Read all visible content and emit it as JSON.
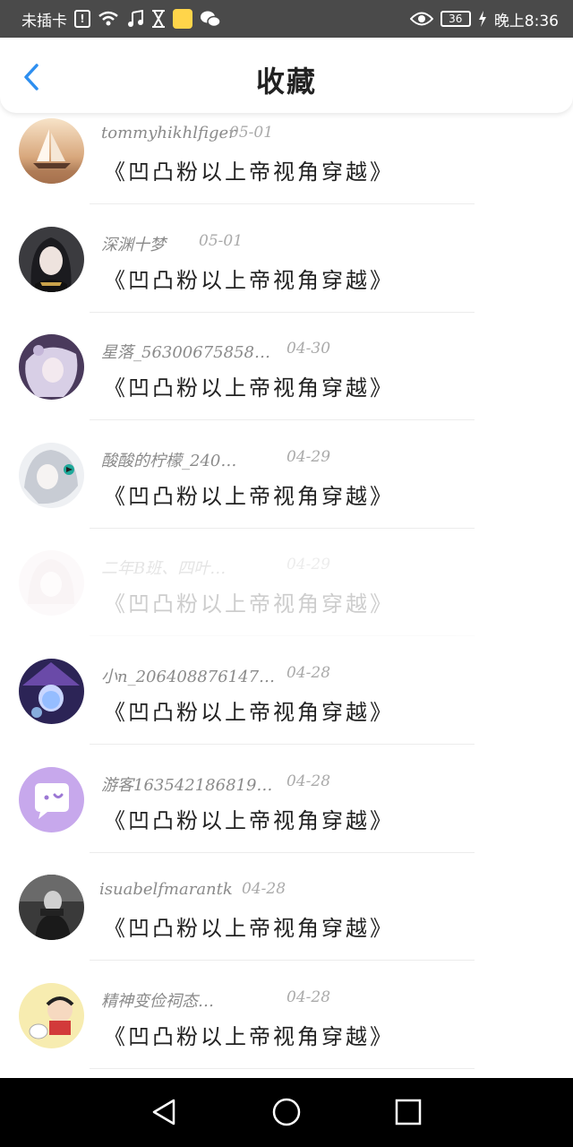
{
  "status_bar": {
    "carrier": "未插卡",
    "battery": "36",
    "time": "晚上8:36",
    "colors": {
      "bg": "#4a4a4a",
      "fg": "#ffffff"
    },
    "icons": [
      "alert-box-icon",
      "wifi-icon",
      "music-note-icon",
      "hourglass-icon",
      "app-notification-icon",
      "wechat-icon",
      "eye-icon",
      "battery-icon",
      "charging-bolt-icon"
    ]
  },
  "header": {
    "title": "收藏",
    "back_icon": "chevron-left-icon",
    "accent": "#2e8ff0"
  },
  "items": [
    {
      "username": "tommyhikhlfiger",
      "date": "05-01",
      "title": "《凹凸粉以上帝视角穿越》",
      "avatar": "sailboat-sunset-avatar"
    },
    {
      "username": "深渊十梦",
      "date": "05-01",
      "title": "《凹凸粉以上帝视角穿越》",
      "avatar": "anime-girl-dark-avatar"
    },
    {
      "username": "星落_56300675858…",
      "date": "04-30",
      "title": "《凹凸粉以上帝视角穿越》",
      "avatar": "anime-pink-avatar"
    },
    {
      "username": "酸酸的柠檬_240…",
      "date": "04-29",
      "title": "《凹凸粉以上帝视角穿越》",
      "avatar": "anime-silver-avatar"
    },
    {
      "username": "二年B班、四叶…",
      "date": "04-29",
      "title": "《凹凸粉以上帝视角穿越》",
      "avatar": "anime-faded-avatar"
    },
    {
      "username": "小n_206408876147…",
      "date": "04-28",
      "title": "《凹凸粉以上帝视角穿越》",
      "avatar": "anime-purple-hat-avatar"
    },
    {
      "username": "游客163542186819…",
      "date": "04-28",
      "title": "《凹凸粉以上帝视角穿越》",
      "avatar": "chat-bubble-default-avatar"
    },
    {
      "username": "isuabelfmarantk",
      "date": "04-28",
      "title": "《凹凸粉以上帝视角穿越》",
      "avatar": "bw-photo-avatar"
    },
    {
      "username": "精神变俭祠态…",
      "date": "04-28",
      "title": "《凹凸粉以上帝视角穿越》",
      "avatar": "crayon-shin-chan-avatar"
    }
  ],
  "nav_bar": {
    "icons": [
      "back-triangle-icon",
      "home-circle-icon",
      "recents-square-icon"
    ]
  }
}
